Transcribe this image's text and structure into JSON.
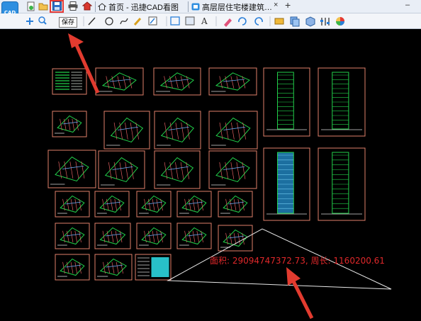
{
  "app": {
    "logo_text": "CAD"
  },
  "tabs": [
    {
      "label": "首页 - 迅捷CAD看图"
    },
    {
      "label": "高层层住宅楼建筑…"
    }
  ],
  "tooltip": {
    "text": "保存"
  },
  "measure": {
    "text": "面积: 29094747372.73, 周长: 1160200.61"
  },
  "colors": {
    "accent": "#e53935",
    "annotation": "#e0282a",
    "frame": "#e0806a",
    "drawing": "#22d04a",
    "canvas": "#000000"
  }
}
